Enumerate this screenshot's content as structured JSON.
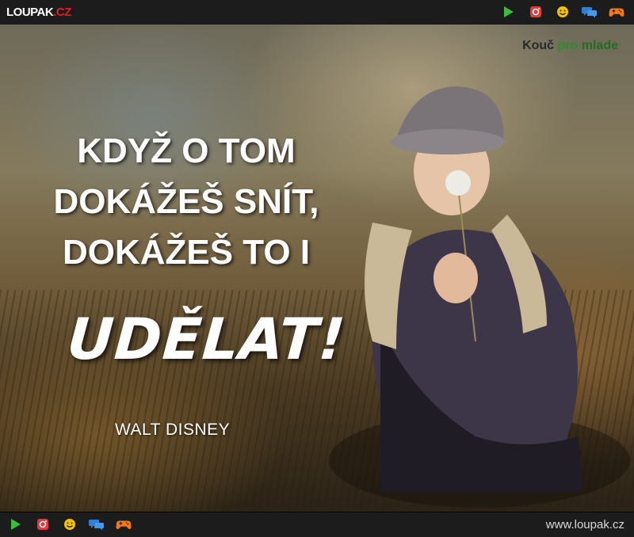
{
  "header": {
    "logo_main": "LOUPAK",
    "logo_dot": ".",
    "logo_tld": "CZ",
    "icons": [
      "play-icon",
      "instagram-icon",
      "smiley-icon",
      "chat-icon",
      "gamepad-icon"
    ]
  },
  "image": {
    "watermark_k": "Kouč",
    "watermark_pro": "pro",
    "watermark_mlade": "mlade",
    "quote_line1": "KDYŽ O TOM",
    "quote_line2": "DOKÁŽEŠ SNÍT,",
    "quote_line3": "DOKÁŽEŠ TO I",
    "quote_emphasis": "UDĚLAT!",
    "author": "WALT DISNEY"
  },
  "footer": {
    "icons": [
      "play-icon",
      "instagram-icon",
      "smiley-icon",
      "chat-icon",
      "gamepad-icon"
    ],
    "site_url": "www.loupak.cz"
  },
  "colors": {
    "bar_bg": "#1c1c1c",
    "play": "#3dbb3d",
    "instagram": "#e03a3a",
    "smiley": "#f2c200",
    "chat": "#2f7fd6",
    "gamepad": "#f07a1a",
    "logo_tld": "#e02020"
  }
}
